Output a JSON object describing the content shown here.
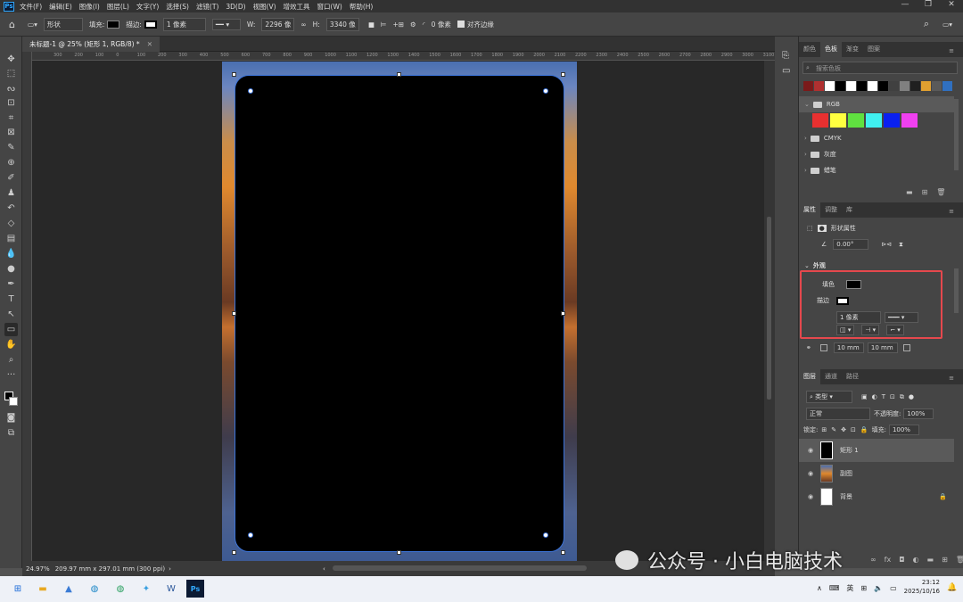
{
  "app": {
    "logo": "Ps"
  },
  "menu": [
    "文件(F)",
    "编辑(E)",
    "图像(I)",
    "图层(L)",
    "文字(Y)",
    "选择(S)",
    "滤镜(T)",
    "3D(D)",
    "视图(V)",
    "增效工具",
    "窗口(W)",
    "帮助(H)"
  ],
  "options": {
    "mode": "形状",
    "fill_label": "填充:",
    "stroke_label": "描边:",
    "stroke_width": "1 像素",
    "w_label": "W:",
    "w_value": "2296 像",
    "h_label": "H:",
    "h_value": "3340 像",
    "radius": "0 像素",
    "align_edges": "对齐边缘"
  },
  "document": {
    "tab_title": "未标题-1 @ 25% (矩形 1, RGB/8) *",
    "zoom": "24.97%",
    "doc_info": "209.97 mm x 297.01 mm (300 ppi)"
  },
  "ruler_ticks": [
    "300",
    "200",
    "100",
    "0",
    "100",
    "200",
    "300",
    "400",
    "500",
    "600",
    "700",
    "800",
    "900",
    "1000",
    "1100",
    "1200",
    "1300",
    "1400",
    "1500",
    "1600",
    "1700",
    "1800",
    "1900",
    "2000",
    "2100",
    "2200",
    "2300",
    "2400",
    "2500",
    "2600",
    "2700",
    "2800",
    "2900",
    "3000",
    "3100"
  ],
  "swatches_panel": {
    "tabs": [
      "颜色",
      "色板",
      "渐变",
      "图案"
    ],
    "active_tab": "色板",
    "search_placeholder": "搜索色板",
    "recent": [
      "#7a1a1a",
      "#b03030",
      "#ffffff",
      "#000000",
      "#ffffff",
      "#000000",
      "#ffffff",
      "#000000",
      "#404040",
      "#808080",
      "#202020",
      "#e0a030",
      "#5a5a5a",
      "#3070c0"
    ],
    "groups": [
      "RGB",
      "CMYK",
      "灰度",
      "蜡笔"
    ],
    "rgb_colors": [
      "#e83030",
      "#ffff40",
      "#60e040",
      "#40f0f0",
      "#0a20f0",
      "#f040f0"
    ]
  },
  "properties_panel": {
    "tabs": [
      "属性",
      "调整",
      "库"
    ],
    "active_tab": "属性",
    "title": "形状属性",
    "angle": "0.00°",
    "section": "外观",
    "fill_label": "填色",
    "stroke_label": "描边",
    "stroke_width": "1 像素",
    "corner1": "10 mm",
    "corner2": "10 mm"
  },
  "layers_panel": {
    "tabs": [
      "图层",
      "通道",
      "路径"
    ],
    "active_tab": "图层",
    "filter": "类型",
    "blend": "正常",
    "opacity_label": "不透明度:",
    "opacity": "100%",
    "lock_label": "锁定:",
    "fill_label": "填充:",
    "fill": "100%",
    "layers": [
      {
        "name": "矩形 1",
        "selected": true
      },
      {
        "name": "副图",
        "selected": false
      },
      {
        "name": "背景",
        "selected": false
      }
    ]
  },
  "watermark": "公众号 · 小白电脑技术",
  "taskbar": {
    "lang": "英",
    "time": "23:12",
    "date": "2025/10/16"
  }
}
